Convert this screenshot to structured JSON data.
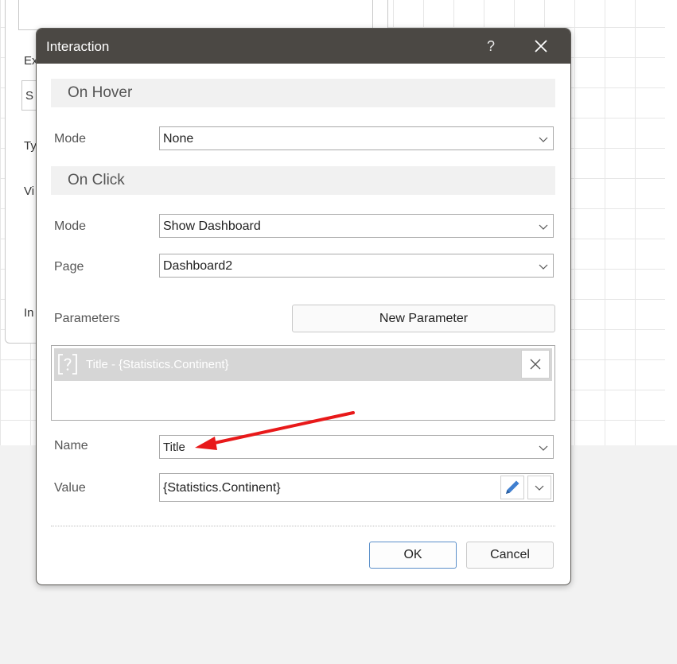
{
  "background": {
    "labels": [
      "Ex",
      "S",
      "Ty",
      "Vi",
      "In"
    ]
  },
  "dialog": {
    "title": "Interaction",
    "help_label": "?",
    "on_hover": {
      "header": "On Hover",
      "mode_label": "Mode",
      "mode_value": "None"
    },
    "on_click": {
      "header": "On Click",
      "mode_label": "Mode",
      "mode_value": "Show Dashboard",
      "page_label": "Page",
      "page_value": "Dashboard2"
    },
    "parameters": {
      "label": "Parameters",
      "new_button": "New Parameter",
      "items": [
        {
          "text": "Title - {Statistics.Continent}"
        }
      ]
    },
    "name_label": "Name",
    "name_value": "Title",
    "value_label": "Value",
    "value_value": "{Statistics.Continent}",
    "ok_label": "OK",
    "cancel_label": "Cancel"
  },
  "colors": {
    "titlebar": "#4b4844",
    "ok_border": "#5b8fc9",
    "annotation_arrow": "#e8191a"
  }
}
